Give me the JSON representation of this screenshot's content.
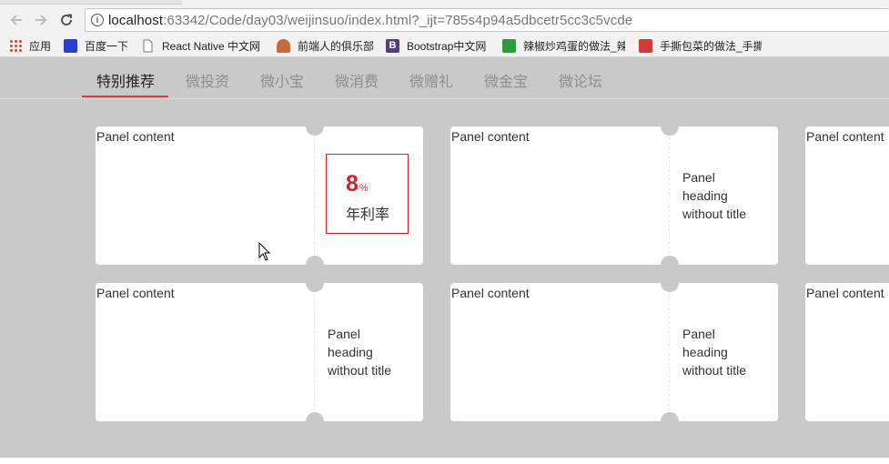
{
  "browser": {
    "url_host": "localhost",
    "url_rest": ":63342/Code/day03/weijinsuo/index.html?_ijt=785s4p94a5dbcetr5cc3c5vcde",
    "back_icon": "arrow-left-icon",
    "forward_icon": "arrow-right-icon",
    "reload_icon": "reload-icon",
    "info_icon": "info-icon",
    "info_glyph": "i"
  },
  "bookmarks": [
    {
      "label": "应用",
      "icon": "apps-grid-icon",
      "color": "#e3453a"
    },
    {
      "label": "百度一下",
      "icon": "baidu-paw-icon",
      "color": "#2a3ec9"
    },
    {
      "label": "React Native 中文网",
      "icon": "page-icon",
      "color": "#777777"
    },
    {
      "label": "前端人的俱乐部",
      "icon": "person-icon",
      "color": "#c66a3a"
    },
    {
      "label": "Bootstrap中文网",
      "icon": "bootstrap-icon",
      "color": "#563d7c"
    },
    {
      "label": "辣椒炒鸡蛋的做法_辣",
      "icon": "recipe-icon",
      "color": "#2e9a3a"
    },
    {
      "label": "手撕包菜的做法_手撕",
      "icon": "recipe-red-icon",
      "color": "#d23a3a"
    }
  ],
  "nav": {
    "tabs": [
      "特别推荐",
      "微投资",
      "微小宝",
      "微消费",
      "微赠礼",
      "微金宝",
      "微论坛"
    ],
    "active_index": 0,
    "accent_color": "#e33b3b"
  },
  "panels": {
    "content_label": "Panel content",
    "heading_lines": [
      "Panel",
      "heading",
      "without title"
    ],
    "rate": {
      "value": "8",
      "unit": "%",
      "label": "年利率",
      "color": "#d9202b"
    }
  }
}
